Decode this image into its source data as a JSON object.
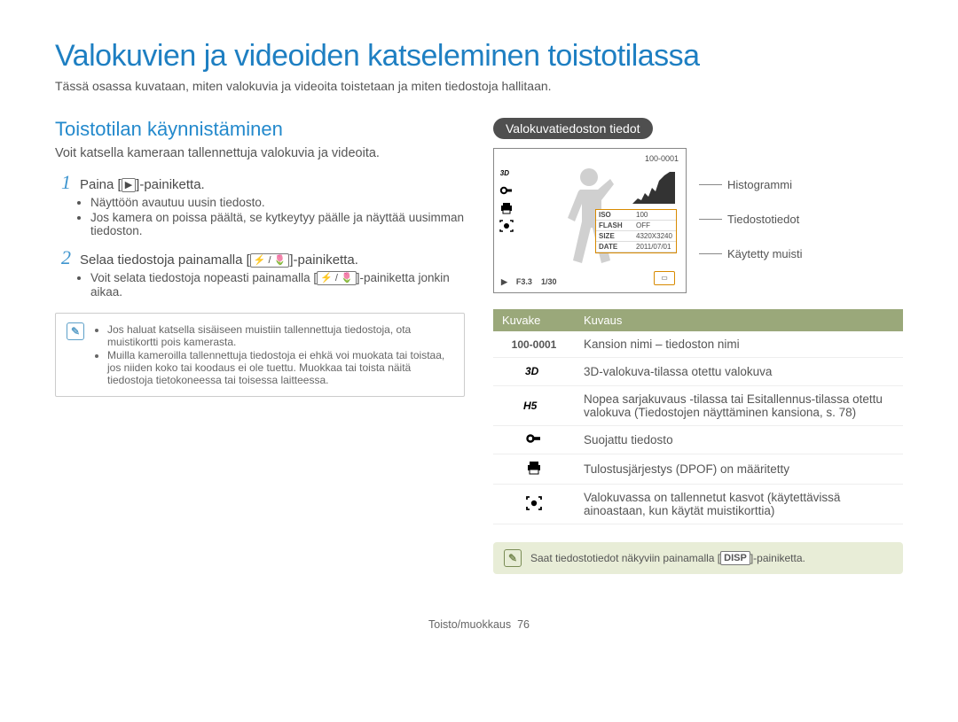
{
  "title": "Valokuvien ja videoiden katseleminen toistotilassa",
  "intro": "Tässä osassa kuvataan, miten valokuvia ja videoita toistetaan ja miten tiedostoja hallitaan.",
  "left": {
    "subhead": "Toistotilan käynnistäminen",
    "lead": "Voit katsella kameraan tallennettuja valokuvia ja videoita.",
    "step1_pre": "Paina [",
    "step1_key": "▶",
    "step1_post": "]-painiketta.",
    "step1_bul1": "Näyttöön avautuu uusin tiedosto.",
    "step1_bul2": "Jos kamera on poissa päältä, se kytkeytyy päälle ja näyttää uusimman tiedoston.",
    "step2_pre": "Selaa tiedostoja painamalla [",
    "step2_key": "⚡ / 🌷",
    "step2_post": "]-painiketta.",
    "step2_bul1_pre": "Voit selata tiedostoja nopeasti painamalla [",
    "step2_bul1_key": "⚡ / 🌷",
    "step2_bul1_post": "]-painiketta jonkin aikaa.",
    "note_bul1": "Jos haluat katsella sisäiseen muistiin tallennettuja tiedostoja, ota muistikortti pois kamerasta.",
    "note_bul2": "Muilla kameroilla tallennettuja tiedostoja ei ehkä voi muokata tai toistaa, jos niiden koko tai koodaus ei ole tuettu. Muokkaa tai toista näitä tiedostoja tietokoneessa tai toisessa laitteessa."
  },
  "right": {
    "pill": "Valokuvatiedoston tiedot",
    "folder_id": "100-0001",
    "info": {
      "iso_label": "ISO",
      "iso_val": "100",
      "flash_label": "FLASH",
      "flash_val": "OFF",
      "size_label": "SIZE",
      "size_val": "4320X3240",
      "date_label": "DATE",
      "date_val": "2011/07/01"
    },
    "bottom_play": "▶",
    "bottom_ap": "F3.3",
    "bottom_sh": "1/30",
    "callout_histogram": "Histogrammi",
    "callout_fileinfo": "Tiedostotiedot",
    "callout_memory": "Käytetty muisti",
    "legend_header_icon": "Kuvake",
    "legend_header_desc": "Kuvaus",
    "rows": {
      "r0_icon": "100-0001",
      "r0_desc": "Kansion nimi – tiedoston nimi",
      "r1_desc": "3D-valokuva-tilassa otettu valokuva",
      "r2_desc": "Nopea sarjakuvaus -tilassa tai Esitallennus-tilassa otettu valokuva (Tiedostojen näyttäminen kansiona, s. 78)",
      "r3_desc": "Suojattu tiedosto",
      "r4_desc": "Tulostusjärjestys (DPOF) on määritetty",
      "r5_desc": "Valokuvassa on tallennetut kasvot (käytettävissä ainoastaan, kun käytät muistikorttia)"
    },
    "tip_pre": "Saat tiedostotiedot näkyviin painamalla [",
    "tip_key": "DISP",
    "tip_post": "]-painiketta."
  },
  "footer_section": "Toisto/muokkaus",
  "footer_page": "76"
}
